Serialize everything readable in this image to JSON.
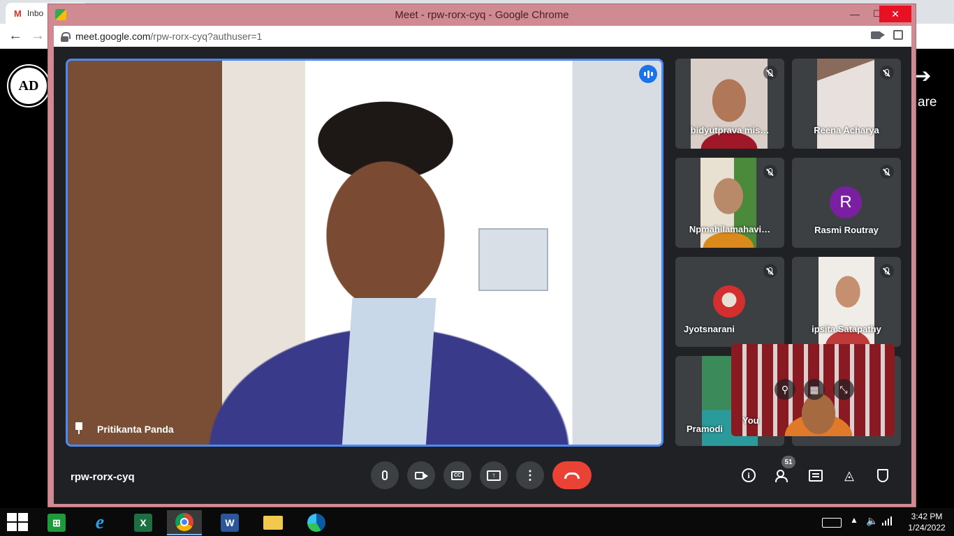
{
  "background_browser": {
    "tab_title": "Inbo",
    "right_partial_text": "are",
    "ad_logo_text": "AD"
  },
  "popup": {
    "window_title": "Meet - rpw-rorx-cyq - Google Chrome",
    "url_host": "meet.google.com",
    "url_path": "/rpw-rorx-cyq?authuser=1"
  },
  "meet": {
    "main_speaker": "Pritikanta Panda",
    "meeting_code": "rpw-rorx-cyq",
    "participant_count": "51",
    "participants": [
      {
        "name": "bidyutprava mis…",
        "muted": true,
        "avatar": "video"
      },
      {
        "name": "Reena Acharya",
        "muted": true,
        "avatar": "video"
      },
      {
        "name": "Npmahilamahavi…",
        "muted": true,
        "avatar": "video"
      },
      {
        "name": "Rasmi Routray",
        "muted": true,
        "avatar": "R",
        "avatar_color": "#7b1fa2"
      },
      {
        "name": "Jyotsnarani",
        "muted": true,
        "avatar": "image"
      },
      {
        "name": "ipsita Satapathy",
        "muted": true,
        "avatar": "video"
      },
      {
        "name": "Pramodi",
        "muted": false,
        "avatar": "video"
      }
    ],
    "self_label": "You",
    "accent_color": "#4c8bf5",
    "end_call_color": "#ea4335"
  },
  "taskbar": {
    "time": "3:42 PM",
    "date": "1/24/2022"
  },
  "icons": {
    "excel_letter": "X",
    "word_letter": "W",
    "ie_letter": "e"
  }
}
